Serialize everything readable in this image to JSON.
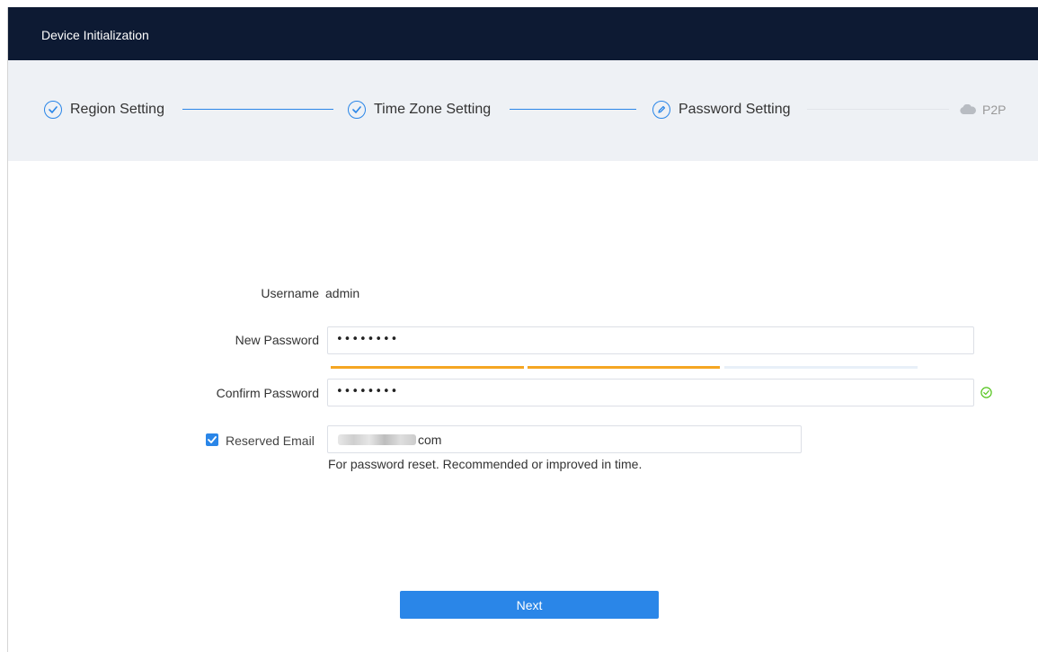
{
  "window": {
    "title": "Device Initialization"
  },
  "stepper": {
    "steps": [
      {
        "label": "Region Setting",
        "status": "done",
        "icon": "check-circle-icon"
      },
      {
        "label": "Time Zone Setting",
        "status": "done",
        "icon": "check-circle-icon"
      },
      {
        "label": "Password Setting",
        "status": "current",
        "icon": "pen-circle-icon"
      },
      {
        "label": "P2P",
        "status": "pending",
        "icon": "cloud-icon"
      }
    ]
  },
  "form": {
    "username": {
      "label": "Username",
      "value": "admin"
    },
    "new_password": {
      "label": "New Password",
      "value": "••••••••"
    },
    "password_strength": {
      "filled_segments": 2,
      "total_segments": 3
    },
    "confirm_password": {
      "label": "Confirm Password",
      "value": "••••••••",
      "match_icon": "check-circle-icon"
    },
    "reserved_email": {
      "label": "Reserved Email",
      "checked": true,
      "value_visible_suffix": "com",
      "hint": "For password reset. Recommended or improved in time."
    }
  },
  "actions": {
    "next_label": "Next"
  },
  "colors": {
    "header_bg": "#0d1a33",
    "stepper_bg": "#eef1f5",
    "accent": "#2a86e8",
    "strength": "#f5a623",
    "success": "#52c41a"
  }
}
